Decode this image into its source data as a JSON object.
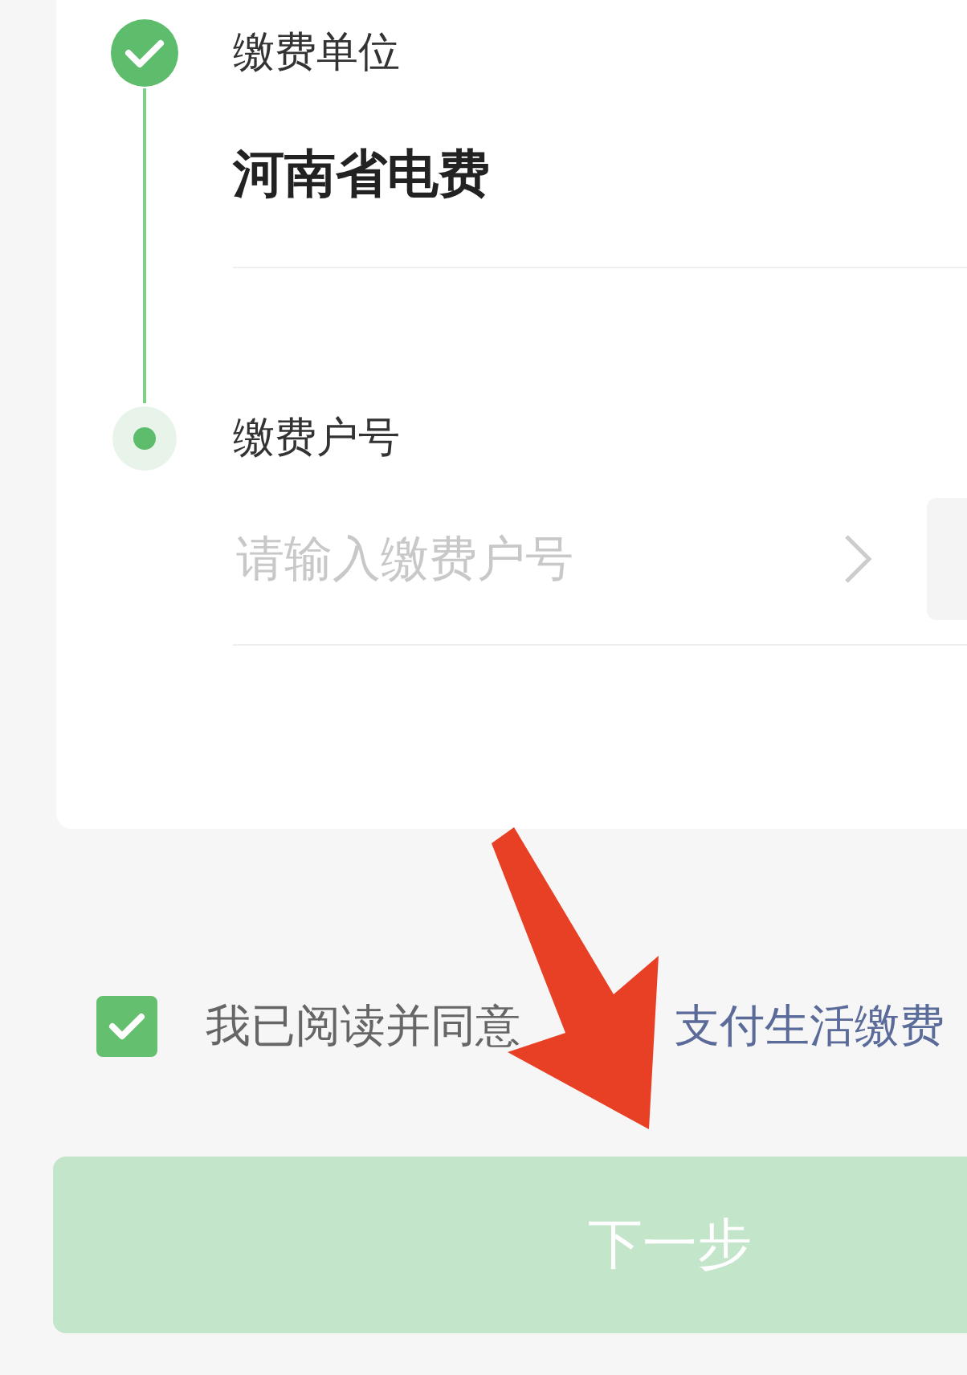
{
  "steps": [
    {
      "label": "缴费单位",
      "completed": true,
      "value": "河南省电费"
    },
    {
      "label": "缴费户号",
      "completed": false,
      "placeholder": "请输入缴费户号"
    }
  ],
  "agreement": {
    "checked": true,
    "text": "我已阅读并同意",
    "link": "支付生活缴费"
  },
  "next_button": {
    "label": "下一步",
    "disabled": true
  },
  "annotation": {
    "kind": "arrow"
  }
}
